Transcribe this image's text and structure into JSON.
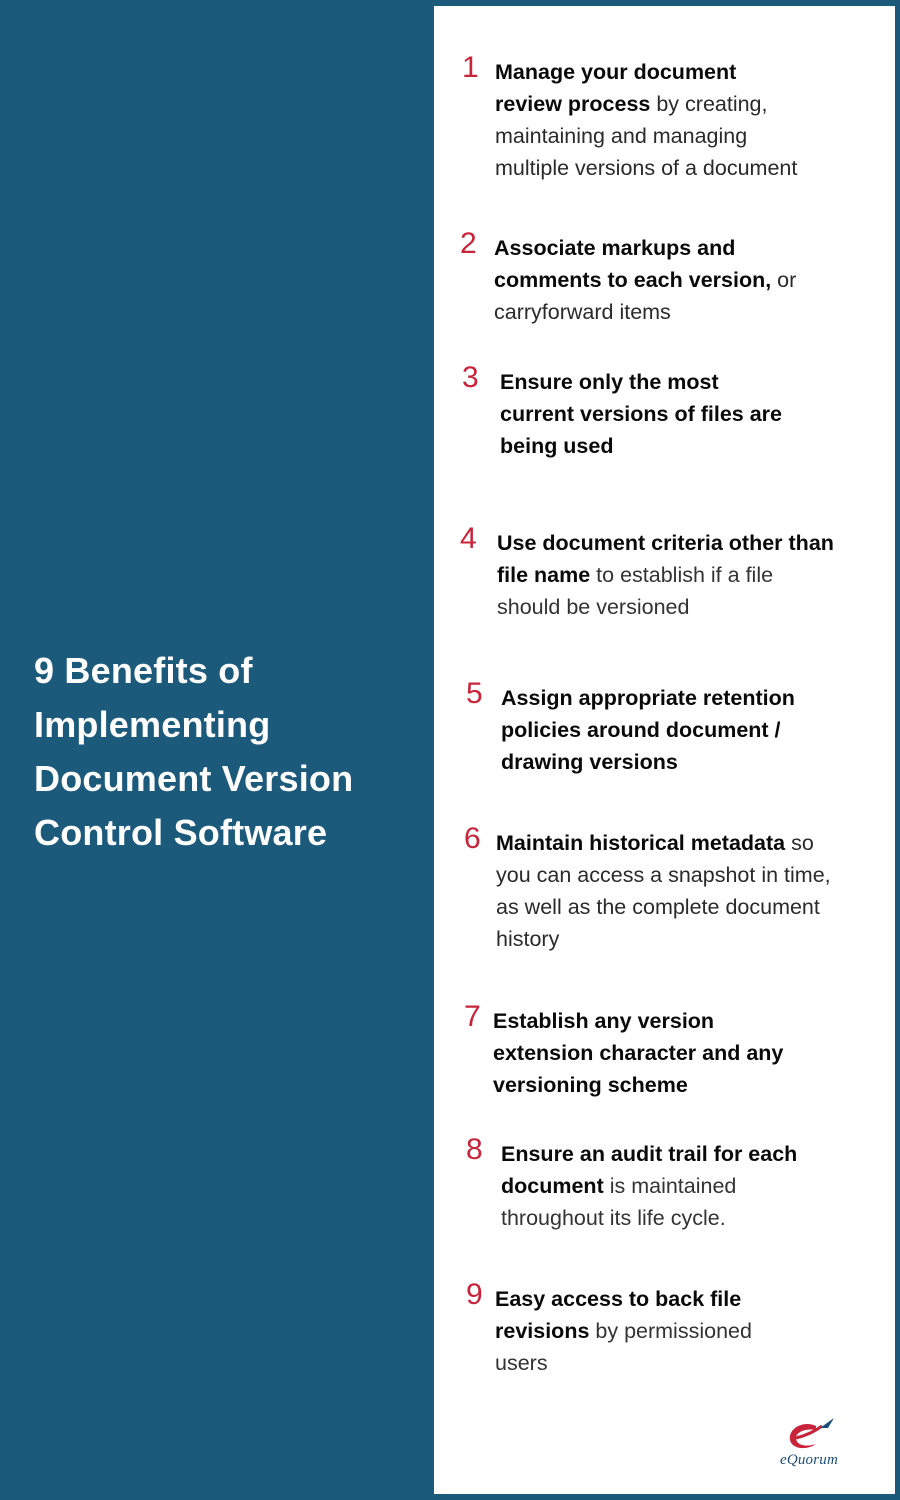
{
  "title": "9 Benefits of Implementing Document Version Control Software",
  "colors": {
    "background": "#1c5a7c",
    "panel": "#ffffff",
    "number": "#c8243a",
    "text": "#111111"
  },
  "benefits": [
    {
      "number": "1",
      "bold": "Manage your document review process",
      "rest": " by creating, maintaining and managing multiple versions of a document"
    },
    {
      "number": "2",
      "bold": "Associate markups and comments to each version,",
      "rest": " or carryforward items"
    },
    {
      "number": "3",
      "bold": "Ensure only the most current versions of files are being used",
      "rest": ""
    },
    {
      "number": "4",
      "bold": "Use document criteria other than file name",
      "rest": " to establish if a file should be versioned"
    },
    {
      "number": "5",
      "bold": "Assign appropriate retention policies around document / drawing versions",
      "rest": ""
    },
    {
      "number": "6",
      "bold": "Maintain historical metadata",
      "rest": " so you can access a snapshot in time, as well as the complete document history"
    },
    {
      "number": "7",
      "bold": "Establish any version extension character and any versioning scheme",
      "rest": ""
    },
    {
      "number": "8",
      "bold": "Ensure an audit trail for each document",
      "rest": " is maintained throughout its life cycle."
    },
    {
      "number": "9",
      "bold": "Easy access to back file revisions",
      "rest": " by permissioned users"
    }
  ],
  "logo": {
    "icon": "equorum-e-quill-icon",
    "text": "eQuorum"
  }
}
